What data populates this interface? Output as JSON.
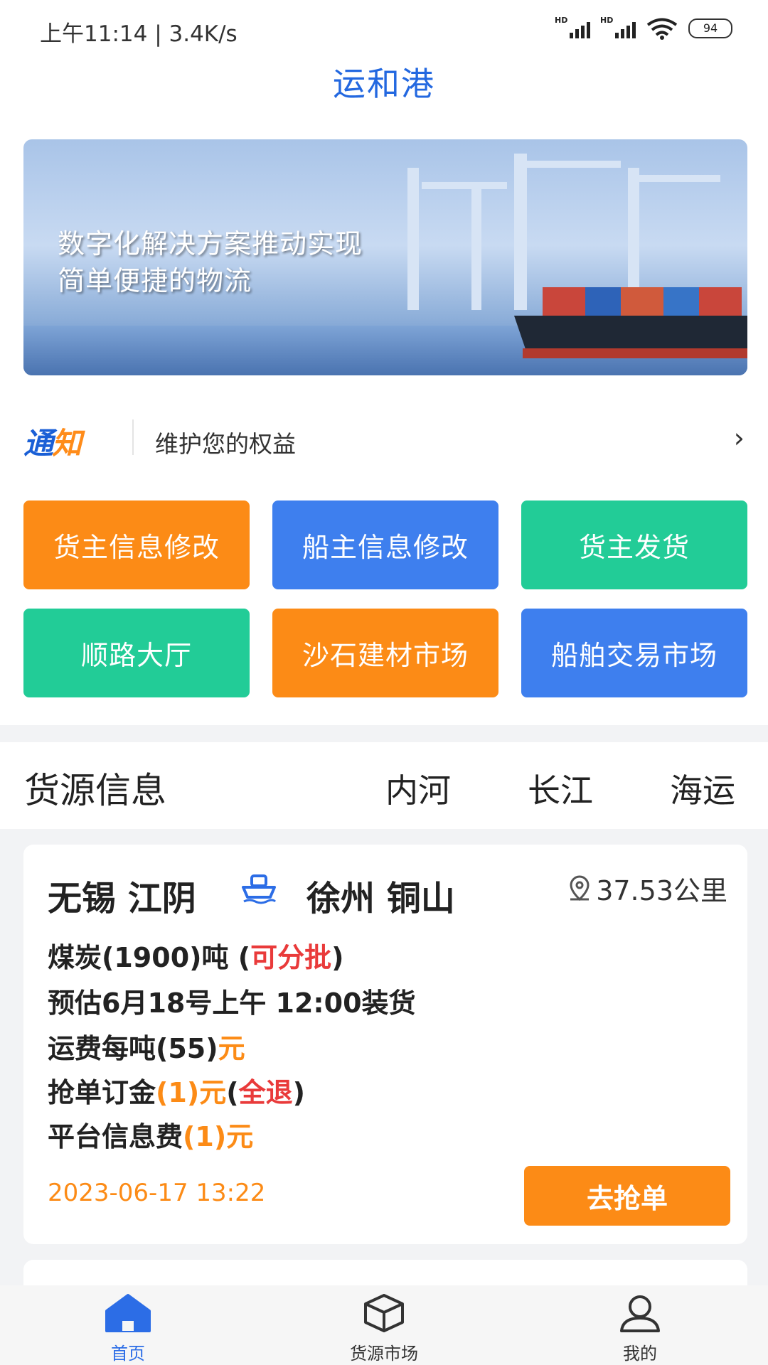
{
  "status_bar": {
    "time_speed": "上午11:14 | 3.4K/s",
    "battery": "94"
  },
  "app": {
    "title": "运和港"
  },
  "banner": {
    "line1": "数字化解决方案推动实现",
    "line2": "简单便捷的物流"
  },
  "notice": {
    "logo_main": "通",
    "logo_accent": "知",
    "text": "维护您的权益",
    "arrow": "›"
  },
  "quick_actions": [
    {
      "label": "货主信息修改",
      "color": "#fc8b16"
    },
    {
      "label": "船主信息修改",
      "color": "#3e7fee"
    },
    {
      "label": "货主发货",
      "color": "#22cc97"
    },
    {
      "label": "顺路大厅",
      "color": "#22cc97"
    },
    {
      "label": "沙石建材市场",
      "color": "#fc8b16"
    },
    {
      "label": "船舶交易市场",
      "color": "#3e7fee"
    }
  ],
  "cargo_section": {
    "title": "货源信息",
    "tabs": [
      "内河",
      "长江",
      "海运"
    ]
  },
  "cargo_card": {
    "origin": "无锡 江阴",
    "destination": "徐州 铜山",
    "distance": "37.53公里",
    "cargo_prefix": "煤炭(1900)吨 (",
    "cargo_batch": "可分批",
    "cargo_suffix": ")",
    "load_time": "预估6月18号上午 12:00装货",
    "freight_prefix": "运费每吨(55)",
    "freight_unit": "元",
    "deposit_prefix": "抢单订金",
    "deposit_value": "(1)元",
    "deposit_open": "(",
    "deposit_refund": "全退",
    "deposit_close": ")",
    "fee_prefix": "平台信息费",
    "fee_value": "(1)元",
    "date": "2023-06-17 13:22",
    "grab_button": "去抢单"
  },
  "tabbar": [
    {
      "label": "首页",
      "icon": "home-icon",
      "active": true
    },
    {
      "label": "货源市场",
      "icon": "box-icon",
      "active": false
    },
    {
      "label": "我的",
      "icon": "user-icon",
      "active": false
    }
  ],
  "colors": {
    "accent_blue": "#2c6de6",
    "accent_orange": "#fc8b16",
    "accent_green": "#22cc97",
    "alert_red": "#e93a3a"
  }
}
